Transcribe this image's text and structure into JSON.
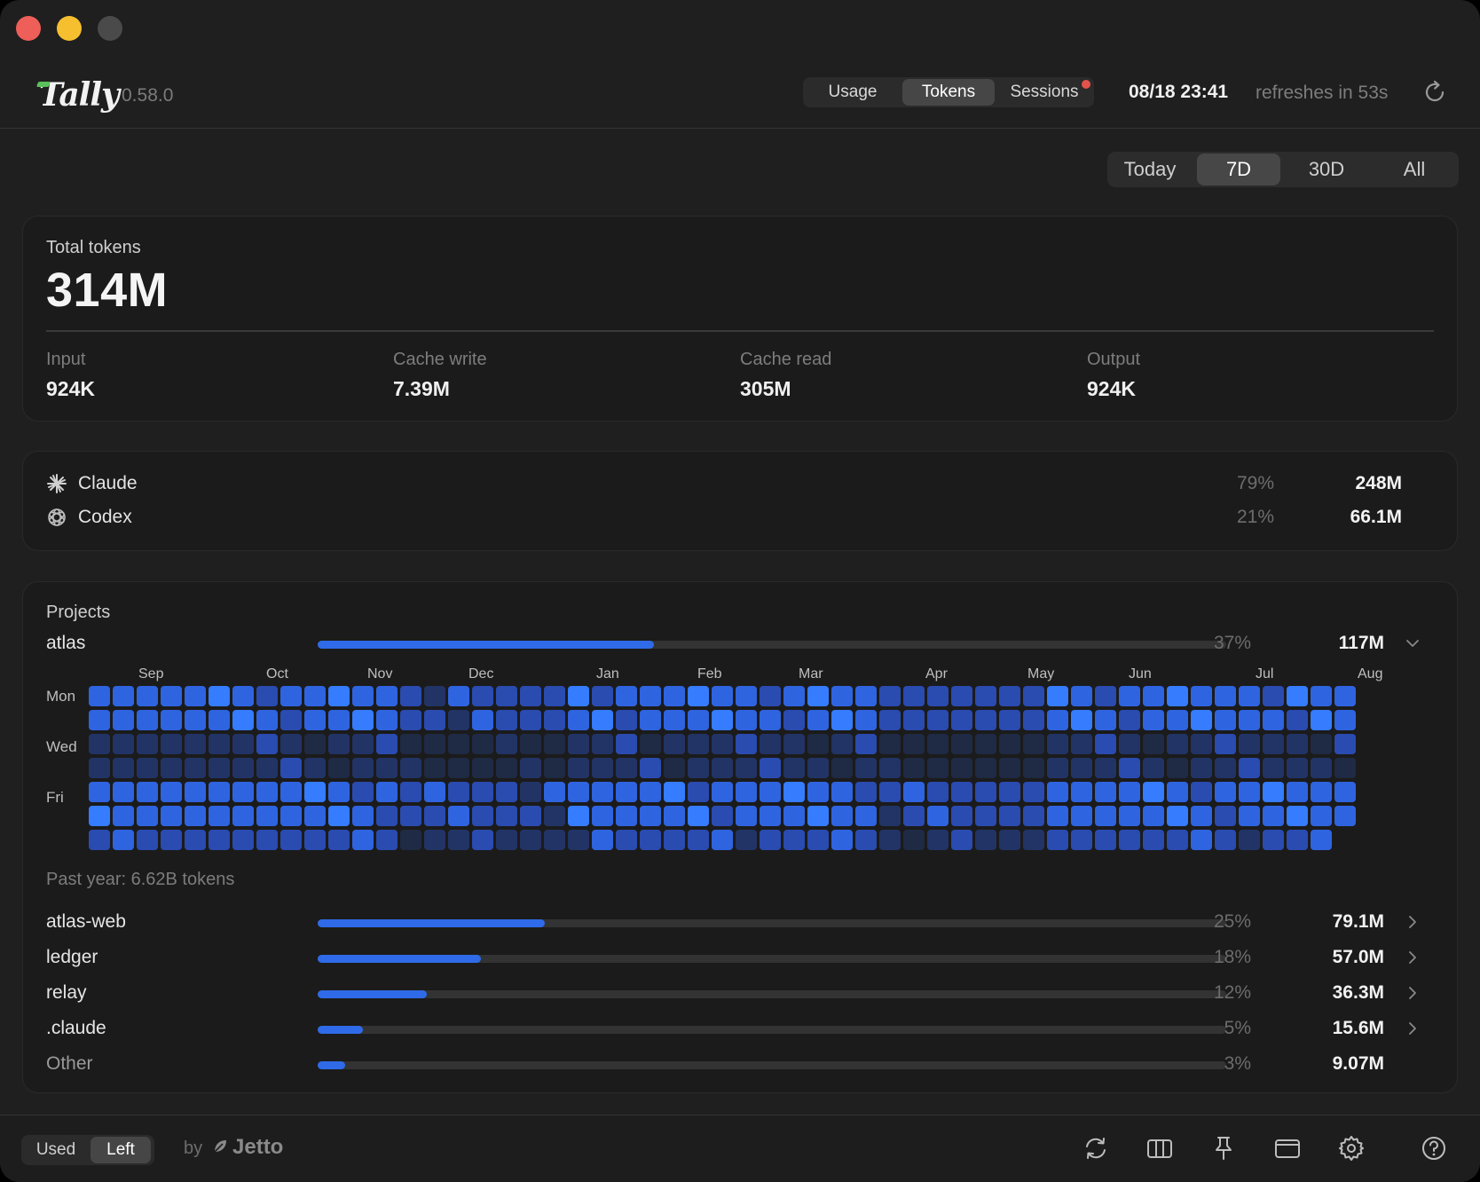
{
  "app": {
    "name": "Tally",
    "version": "0.58.0"
  },
  "header": {
    "tabs": [
      {
        "label": "Usage"
      },
      {
        "label": "Tokens"
      },
      {
        "label": "Sessions"
      }
    ],
    "active_tab": "Tokens",
    "datetime": "08/18 23:41",
    "refresh_text": "refreshes in 53s",
    "refresh_icon": "refresh-icon"
  },
  "range": {
    "options": [
      {
        "label": "Today"
      },
      {
        "label": "7D"
      },
      {
        "label": "30D"
      },
      {
        "label": "All"
      }
    ],
    "active": "7D"
  },
  "totals": {
    "label": "Total tokens",
    "value": "314M",
    "stats": [
      {
        "label": "Input",
        "value": "924K"
      },
      {
        "label": "Cache write",
        "value": "7.39M"
      },
      {
        "label": "Cache read",
        "value": "305M"
      },
      {
        "label": "Output",
        "value": "924K"
      }
    ]
  },
  "providers": [
    {
      "name": "Claude",
      "icon": "claude-sparkle-icon",
      "percent": "79%",
      "value": "248M"
    },
    {
      "name": "Codex",
      "icon": "codex-knot-icon",
      "percent": "21%",
      "value": "66.1M"
    }
  ],
  "projects": {
    "title": "Projects",
    "expanded": {
      "name": "atlas",
      "percent": "37%",
      "value": "117M",
      "fraction": 0.37
    },
    "heatmap": {
      "months": [
        "Sep",
        "Oct",
        "Nov",
        "Dec",
        "Jan",
        "Feb",
        "Mar",
        "Apr",
        "May",
        "Jun",
        "Jul",
        "Aug"
      ],
      "day_labels": [
        "Mon",
        "Wed",
        "Fri"
      ],
      "columns": 53,
      "summary": "Past year: 6.62B tokens"
    },
    "rows": [
      {
        "name": "atlas-web",
        "percent": "25%",
        "value": "79.1M",
        "fraction": 0.25,
        "muted": false
      },
      {
        "name": "ledger",
        "percent": "18%",
        "value": "57.0M",
        "fraction": 0.18,
        "muted": false
      },
      {
        "name": "relay",
        "percent": "12%",
        "value": "36.3M",
        "fraction": 0.12,
        "muted": false
      },
      {
        "name": ".claude",
        "percent": "5%",
        "value": "15.6M",
        "fraction": 0.05,
        "muted": false
      },
      {
        "name": "Other",
        "percent": "3%",
        "value": "9.07M",
        "fraction": 0.03,
        "muted": true
      }
    ]
  },
  "footer": {
    "toggle": [
      {
        "label": "Used"
      },
      {
        "label": "Left"
      }
    ],
    "active_toggle": "Left",
    "by": "by",
    "brand": "Jetto",
    "icons": [
      "sync-icon",
      "columns-icon",
      "pin-icon",
      "window-icon",
      "gear-icon",
      "help-icon"
    ]
  },
  "colors": {
    "accent": "#2f6be8",
    "heat_levels": [
      "#1f2a44",
      "#223466",
      "#2a4bb0",
      "#2f64e0",
      "#357cff"
    ]
  }
}
